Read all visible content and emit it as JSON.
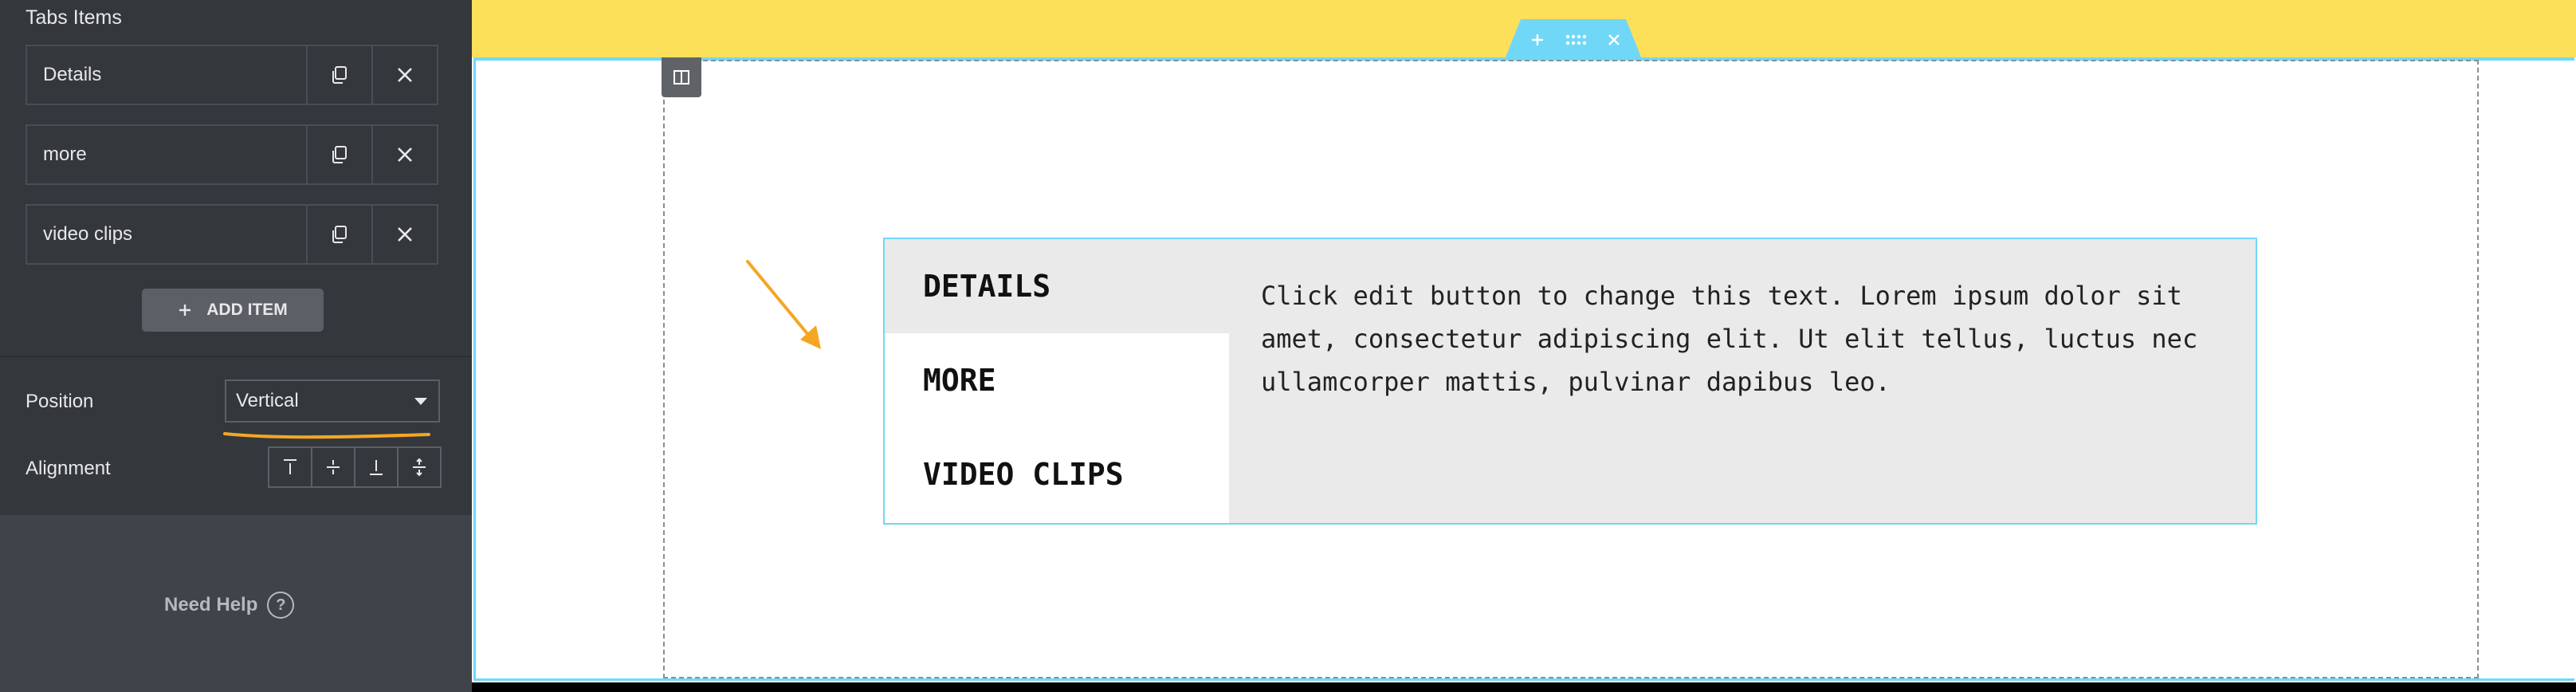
{
  "panel": {
    "section_title": "Tabs Items",
    "items": [
      {
        "label": "Details"
      },
      {
        "label": "more"
      },
      {
        "label": "video clips"
      }
    ],
    "add_item_label": "ADD ITEM",
    "position": {
      "label": "Position",
      "value": "Vertical"
    },
    "alignment": {
      "label": "Alignment",
      "options": [
        "top-icon",
        "middle-icon",
        "bottom-icon",
        "stretch-icon"
      ]
    },
    "need_help_label": "Need Help"
  },
  "canvas": {
    "tabs": [
      {
        "title": "DETAILS",
        "active": true
      },
      {
        "title": "MORE",
        "active": false
      },
      {
        "title": "VIDEO CLIPS",
        "active": false
      }
    ],
    "content_text": "Click edit button to change this text. Lorem ipsum dolor sit amet, consectetur adipiscing elit. Ut elit tellus, luctus nec ullamcorper mattis, pulvinar dapibus leo."
  },
  "colors": {
    "panel_bg": "#34383c",
    "section_accent": "#71d7f7",
    "section_bg": "#fde05a",
    "annotation": "#f5a623"
  }
}
